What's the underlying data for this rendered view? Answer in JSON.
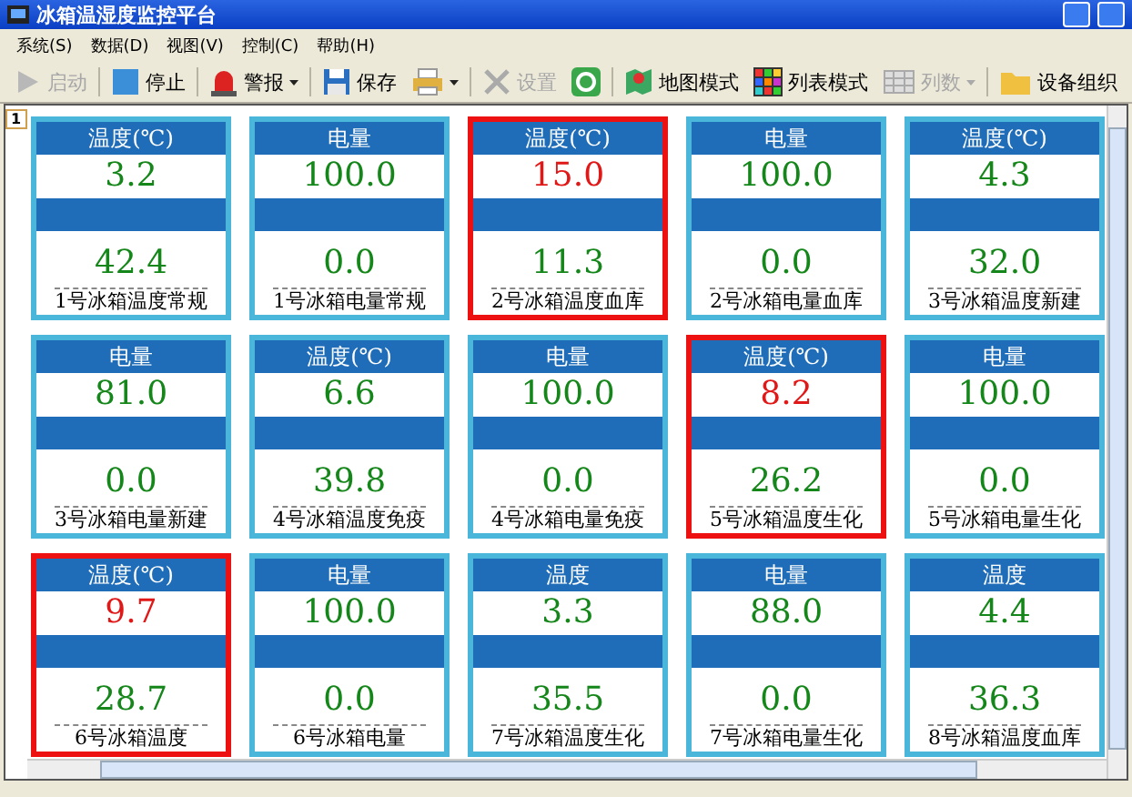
{
  "window": {
    "title": "冰箱温湿度监控平台"
  },
  "menu": [
    {
      "label": "系统(S)"
    },
    {
      "label": "数据(D)"
    },
    {
      "label": "视图(V)"
    },
    {
      "label": "控制(C)"
    },
    {
      "label": "帮助(H)"
    }
  ],
  "toolbar": [
    {
      "label": "启动",
      "disabled": true,
      "dropdown": false
    },
    {
      "label": "停止",
      "disabled": false,
      "dropdown": false
    },
    {
      "label": "警报",
      "disabled": false,
      "dropdown": true
    },
    {
      "label": "保存",
      "disabled": false,
      "dropdown": false
    },
    {
      "disabled": false,
      "dropdown": true
    },
    {
      "label": "设置",
      "disabled": true,
      "dropdown": false
    },
    {
      "disabled": false,
      "dropdown": false
    },
    {
      "label": "地图模式",
      "disabled": false,
      "dropdown": false
    },
    {
      "label": "列表模式",
      "disabled": false,
      "dropdown": false
    },
    {
      "label": "列数",
      "disabled": true,
      "dropdown": true
    },
    {
      "label": "设备组织",
      "disabled": false,
      "dropdown": false
    }
  ],
  "page_tab": {
    "label": "1"
  },
  "cards": [
    {
      "title": "温度(℃)",
      "value": "3.2",
      "value_2": "42.4",
      "label": "1号冰箱温度常规",
      "alert": false
    },
    {
      "title": "电量",
      "value": "100.0",
      "value_2": "0.0",
      "label": "1号冰箱电量常规",
      "alert": false
    },
    {
      "title": "温度(℃)",
      "value": "15.0",
      "value_2": "11.3",
      "label": "2号冰箱温度血库",
      "alert": true
    },
    {
      "title": "电量",
      "value": "100.0",
      "value_2": "0.0",
      "label": "2号冰箱电量血库",
      "alert": false
    },
    {
      "title": "温度(℃)",
      "value": "4.3",
      "value_2": "32.0",
      "label": "3号冰箱温度新建",
      "alert": false
    },
    {
      "title": "电量",
      "value": "81.0",
      "value_2": "0.0",
      "label": "3号冰箱电量新建",
      "alert": false
    },
    {
      "title": "温度(℃)",
      "value": "6.6",
      "value_2": "39.8",
      "label": "4号冰箱温度免疫",
      "alert": false
    },
    {
      "title": "电量",
      "value": "100.0",
      "value_2": "0.0",
      "label": "4号冰箱电量免疫",
      "alert": false
    },
    {
      "title": "温度(℃)",
      "value": "8.2",
      "value_2": "26.2",
      "label": "5号冰箱温度生化",
      "alert": true
    },
    {
      "title": "电量",
      "value": "100.0",
      "value_2": "0.0",
      "label": "5号冰箱电量生化",
      "alert": false
    },
    {
      "title": "温度(℃)",
      "value": "9.7",
      "value_2": "28.7",
      "label": "6号冰箱温度",
      "alert": true
    },
    {
      "title": "电量",
      "value": "100.0",
      "value_2": "0.0",
      "label": "6号冰箱电量",
      "alert": false
    },
    {
      "title": "温度",
      "value": "3.3",
      "value_2": "35.5",
      "label": "7号冰箱温度生化",
      "alert": false
    },
    {
      "title": "电量",
      "value": "88.0",
      "value_2": "0.0",
      "label": "7号冰箱电量生化",
      "alert": false
    },
    {
      "title": "温度",
      "value": "4.4",
      "value_2": "36.3",
      "label": "8号冰箱温度血库",
      "alert": false
    }
  ]
}
